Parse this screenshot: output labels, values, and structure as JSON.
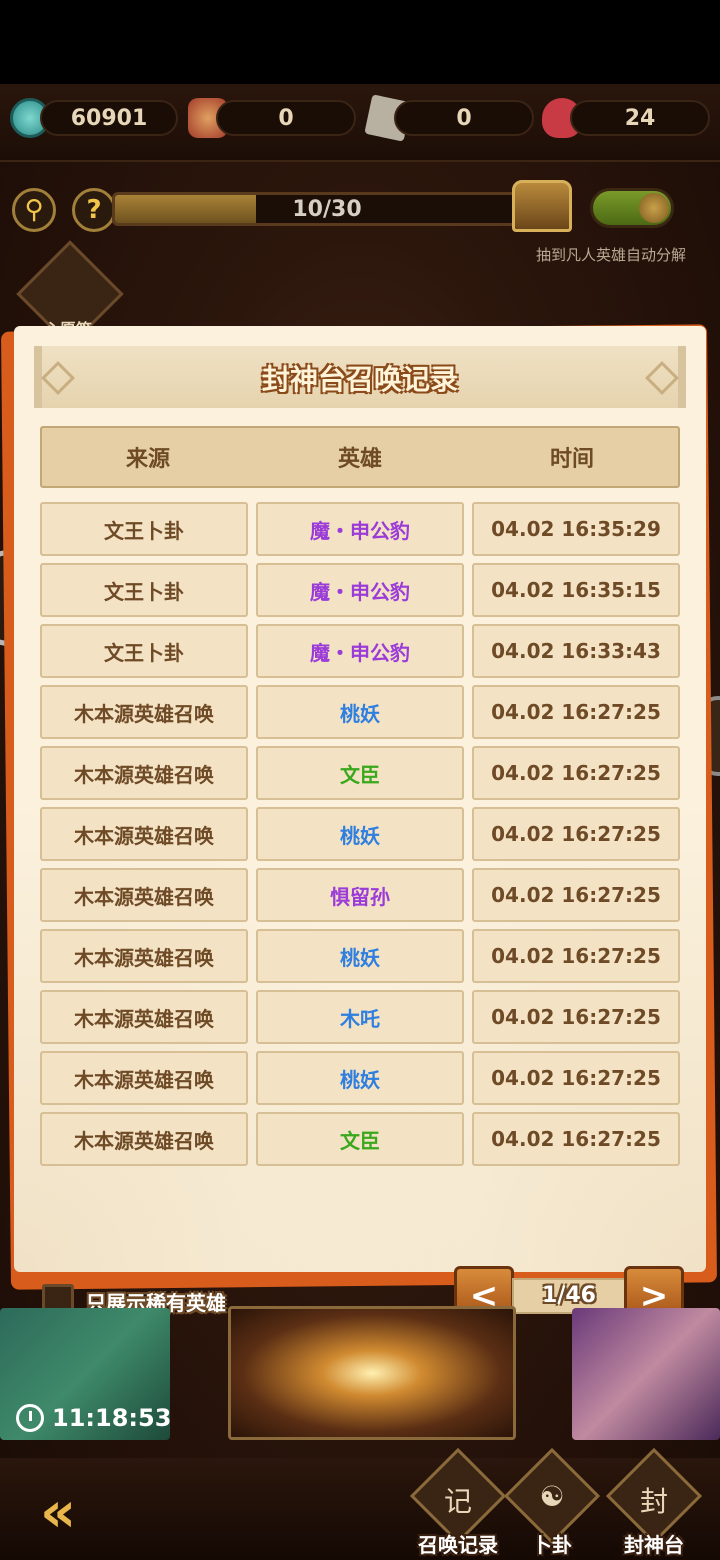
{
  "resources": {
    "coins": "60901",
    "bag": "0",
    "scroll": "0",
    "hearts": "24"
  },
  "controls": {
    "search_icon": "search-icon",
    "help_symbol": "?",
    "progress_text": "10/30",
    "progress_fraction": 0.3333,
    "auto_decompose_label": "抽到凡人英雄自动分解",
    "wish_label": "心愿签"
  },
  "dialog": {
    "title": "封神台召唤记录",
    "headers": {
      "source": "来源",
      "hero": "英雄",
      "time": "时间"
    },
    "rows": [
      {
        "source": "文王卜卦",
        "hero": "魔・申公豹",
        "time": "04.02 16:35:29",
        "color": "#9b3cd8"
      },
      {
        "source": "文王卜卦",
        "hero": "魔・申公豹",
        "time": "04.02 16:35:15",
        "color": "#9b3cd8"
      },
      {
        "source": "文王卜卦",
        "hero": "魔・申公豹",
        "time": "04.02 16:33:43",
        "color": "#9b3cd8"
      },
      {
        "source": "木本源英雄召唤",
        "hero": "桃妖",
        "time": "04.02 16:27:25",
        "color": "#2e7fe0"
      },
      {
        "source": "木本源英雄召唤",
        "hero": "文臣",
        "time": "04.02 16:27:25",
        "color": "#3aa81c"
      },
      {
        "source": "木本源英雄召唤",
        "hero": "桃妖",
        "time": "04.02 16:27:25",
        "color": "#2e7fe0"
      },
      {
        "source": "木本源英雄召唤",
        "hero": "惧留孙",
        "time": "04.02 16:27:25",
        "color": "#9b3cd8"
      },
      {
        "source": "木本源英雄召唤",
        "hero": "桃妖",
        "time": "04.02 16:27:25",
        "color": "#2e7fe0"
      },
      {
        "source": "木本源英雄召唤",
        "hero": "木吒",
        "time": "04.02 16:27:25",
        "color": "#2e7fe0"
      },
      {
        "source": "木本源英雄召唤",
        "hero": "桃妖",
        "time": "04.02 16:27:25",
        "color": "#2e7fe0"
      },
      {
        "source": "木本源英雄召唤",
        "hero": "文臣",
        "time": "04.02 16:27:25",
        "color": "#3aa81c"
      }
    ],
    "filter_label": "只展示稀有英雄",
    "pager": {
      "prev": "<",
      "next": ">",
      "text": "1/46"
    }
  },
  "cards": {
    "timer": "11:18:53"
  },
  "nav": {
    "back_symbol": "«",
    "items": [
      {
        "label": "召唤记录",
        "symbol": "记"
      },
      {
        "label": "卜卦",
        "symbol": "☯"
      },
      {
        "label": "封神台",
        "symbol": "封"
      }
    ]
  }
}
